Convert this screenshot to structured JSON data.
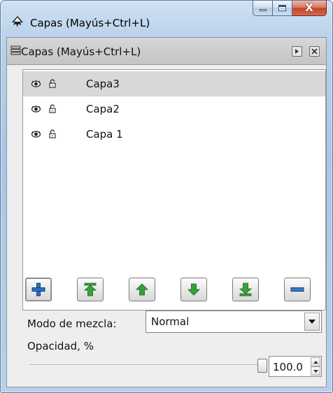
{
  "window": {
    "title": "Capas (Mayús+Ctrl+L)",
    "close_glyph": "X"
  },
  "dock": {
    "title": "Capas (Mayús+Ctrl+L)"
  },
  "layers": [
    {
      "name": "Capa3",
      "selected": true
    },
    {
      "name": "Capa2",
      "selected": false
    },
    {
      "name": "Capa 1",
      "selected": false
    }
  ],
  "toolbar": {
    "buttons": [
      {
        "id": "add",
        "icon": "plus-icon"
      },
      {
        "id": "raise-top",
        "icon": "raise-to-top-icon"
      },
      {
        "id": "raise",
        "icon": "raise-icon"
      },
      {
        "id": "lower",
        "icon": "lower-icon"
      },
      {
        "id": "lower-bottom",
        "icon": "lower-to-bottom-icon"
      },
      {
        "id": "remove",
        "icon": "minus-icon"
      }
    ]
  },
  "blend": {
    "label": "Modo de mezcla:",
    "value": "Normal"
  },
  "opacity": {
    "label": "Opacidad, %",
    "value": "100.0",
    "fraction": 1.0
  },
  "colors": {
    "add_blue": "#2a6fc8",
    "arrow_green": "#3aa03a",
    "remove_blue": "#3a78cf"
  }
}
